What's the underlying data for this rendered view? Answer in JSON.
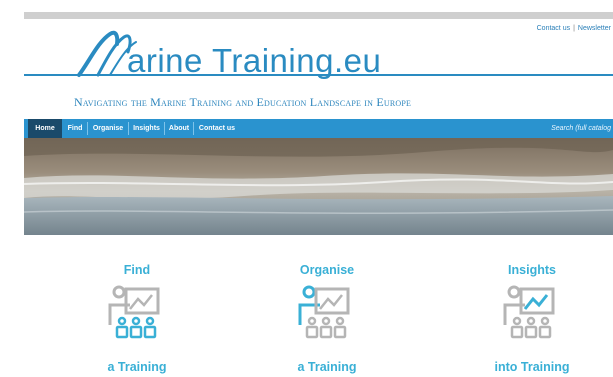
{
  "header": {
    "links": [
      "Contact us",
      "Newsletter"
    ],
    "logo_text": "arine Training.eu",
    "tagline": "Navigating the Marine Training and Education Landscape in Europe"
  },
  "nav": {
    "items": [
      "Home",
      "Find",
      "Organise",
      "Insights",
      "About",
      "Contact us"
    ],
    "search_placeholder": "Search (full catalog"
  },
  "cards": [
    {
      "title": "Find",
      "subtitle": "a Training",
      "highlight": "people",
      "icon": "find-training-icon"
    },
    {
      "title": "Organise",
      "subtitle": "a Training",
      "highlight": "person",
      "icon": "organise-training-icon"
    },
    {
      "title": "Insights",
      "subtitle": "into Training",
      "highlight": "chart",
      "icon": "insights-training-icon"
    }
  ],
  "colors": {
    "brand_blue": "#2a8bc1",
    "nav_blue": "#2a93cf",
    "nav_home": "#1a4a6a",
    "card_blue": "#3ab0d6",
    "card_grey": "#b5b5b5"
  }
}
